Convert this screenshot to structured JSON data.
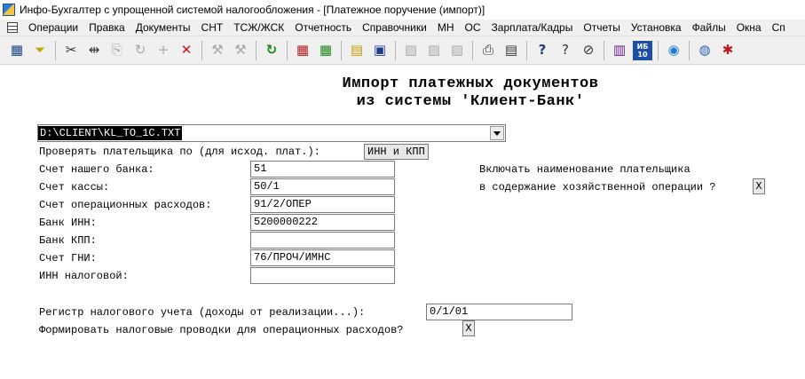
{
  "window": {
    "title": "Инфо-Бухгалтер с упрощенной системой налогообложения - [Платежное поручение (импорт)]"
  },
  "menu": [
    "Операции",
    "Правка",
    "Документы",
    "СНТ",
    "ТСЖ/ЖСК",
    "Отчетность",
    "Справочники",
    "МН",
    "ОС",
    "Зарплата/Кадры",
    "Отчеты",
    "Установка",
    "Файлы",
    "Окна",
    "Сп"
  ],
  "toolbar": {
    "calendar_icon": "▦",
    "filter_icon": "⏷",
    "cut_icon": "✂",
    "split_icon": "⇹",
    "copy_icon": "⎘",
    "rotate_icon": "↻",
    "add_icon": "+",
    "delete_icon": "✕",
    "tool1_icon": "⚒",
    "tool2_icon": "⚒",
    "refresh_icon": "↻",
    "calc_icon": "▦",
    "open_icon": "▤",
    "save_icon": "▣",
    "img1_icon": "▨",
    "img2_icon": "▨",
    "img3_icon": "▨",
    "print_icon": "⎙",
    "preview_icon": "▤",
    "help_icon": "?",
    "context_help_icon": "?",
    "compass_icon": "⊘",
    "book_icon": "▥",
    "ib_label": "ИБ 10",
    "blue1_icon": "◉",
    "globe_icon": "◍",
    "snow_icon": "✱"
  },
  "form": {
    "heading_line1": "Импорт платежных документов",
    "heading_line2": "из системы 'Клиент-Банк'",
    "file_path": "D:\\CLIENT\\KL_TO_1C.TXT",
    "check_payer_label": "Проверять плательщика по (для исход. плат.):",
    "check_payer_value": "ИНН и КПП",
    "our_bank_account_label": "Счет нашего банка:",
    "our_bank_account_value": "51",
    "cash_account_label": "Счет кассы:",
    "cash_account_value": "50/1",
    "operations_expense_label": "Счет операционных расходов:",
    "operations_expense_value": "91/2/ОПЕР",
    "bank_inn_label": "Банк ИНН:",
    "bank_inn_value": "5200000222",
    "bank_kpp_label": "Банк КПП:",
    "bank_kpp_value": "",
    "gni_account_label": "Счет ГНИ:",
    "gni_account_value": "76/ПРОЧ/ИМНС",
    "tax_inn_label": "ИНН налоговой:",
    "tax_inn_value": "",
    "include_payer_line1": "Включать наименование плательщика",
    "include_payer_line2": "в содержание хозяйственной операции ?",
    "include_payer_check": "X",
    "tax_register_label": "Регистр налогового учета (доходы от реализации...):",
    "tax_register_value": "0/1/01",
    "form_tax_entries_label": "Формировать налоговые проводки для операционных расходов?",
    "form_tax_entries_check": "X"
  }
}
